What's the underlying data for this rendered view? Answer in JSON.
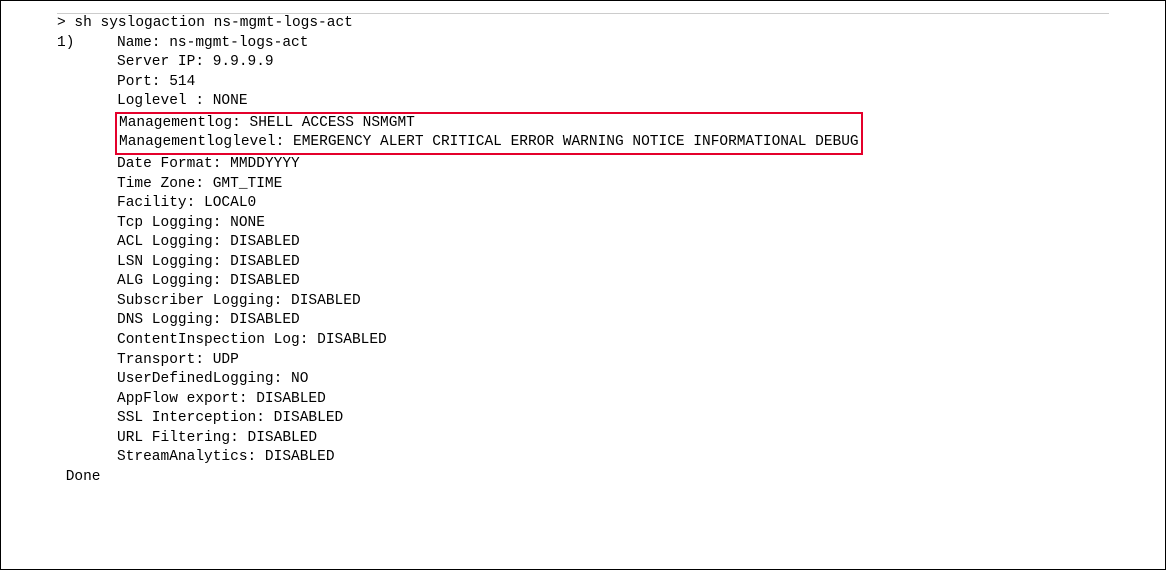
{
  "cmd": {
    "prompt": "> ",
    "command": "sh syslogaction ns-mgmt-logs-act"
  },
  "entry": {
    "index": "1)",
    "name": "Name: ns-mgmt-logs-act",
    "serverip": "Server IP: 9.9.9.9",
    "port": "Port: 514",
    "loglevel": "Loglevel : NONE",
    "mgmtlog": "Managementlog: SHELL ACCESS NSMGMT",
    "mgmtloglevel": "Managementloglevel: EMERGENCY ALERT CRITICAL ERROR WARNING NOTICE INFORMATIONAL DEBUG",
    "dateformat": "Date Format: MMDDYYYY",
    "timezone": "Time Zone: GMT_TIME",
    "facility": "Facility: LOCAL0",
    "tcplogging": "Tcp Logging: NONE",
    "acllogging": "ACL Logging: DISABLED",
    "lsnlogging": "LSN Logging: DISABLED",
    "alglogging": "ALG Logging: DISABLED",
    "sublogging": "Subscriber Logging: DISABLED",
    "dnslogging": "DNS Logging: DISABLED",
    "contentinspection": "ContentInspection Log: DISABLED",
    "transport": "Transport: UDP",
    "userdefinedlogging": "UserDefinedLogging: NO",
    "appflow": "AppFlow export: DISABLED",
    "sslinterception": "SSL Interception: DISABLED",
    "urlfiltering": "URL Filtering: DISABLED",
    "streamanalytics": "StreamAnalytics: DISABLED"
  },
  "done": " Done"
}
